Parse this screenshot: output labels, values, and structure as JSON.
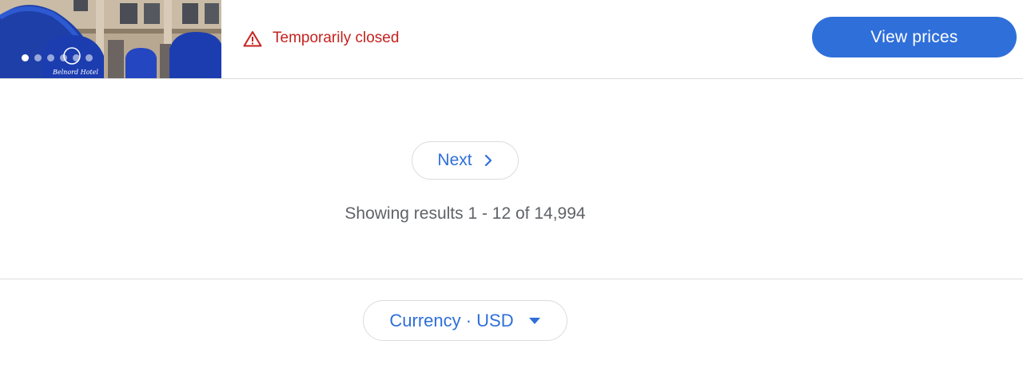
{
  "hotel_card": {
    "status": "Temporarily closed",
    "view_prices_label": "View prices",
    "image_sign_text": "Belnord Hotel",
    "carousel": {
      "total": 6,
      "active": 0
    }
  },
  "pagination": {
    "next_label": "Next",
    "results_text": "Showing results 1 - 12 of 14,994"
  },
  "footer": {
    "currency_label": "Currency · USD"
  },
  "colors": {
    "accent": "#2f6fd9",
    "status_red": "#c5221f",
    "muted_text": "#5f6368",
    "divider": "#dadce0"
  },
  "icons": {
    "status": "warning-triangle-icon",
    "next": "chevron-right-icon",
    "currency": "caret-down-icon"
  }
}
